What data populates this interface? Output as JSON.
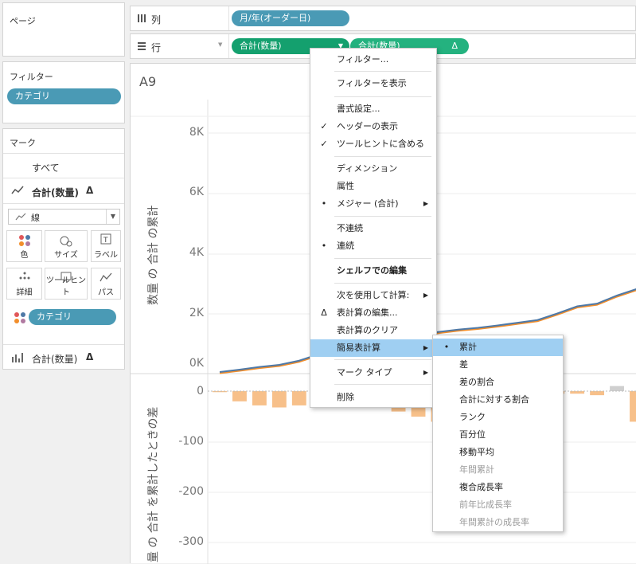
{
  "pages": {
    "title": "ページ"
  },
  "filters": {
    "title": "フィルター",
    "pill": "カテゴリ"
  },
  "marks": {
    "title": "マーク",
    "all": "すべて",
    "measure": "合計(数量)",
    "delta": "Δ",
    "type_select": "線",
    "buttons": {
      "color": "色",
      "size": "サイズ",
      "label": "ラベル",
      "detail": "詳細",
      "tooltip": "ツールヒント",
      "path": "パス"
    },
    "category_pill": "カテゴリ",
    "second_measure": "合計(数量)"
  },
  "shelves": {
    "columns_label": "列",
    "columns_pill": "月/年(オーダー日)",
    "rows_label": "行",
    "rows_pill1": "合計(数量)",
    "rows_pill2": "合計(数量)",
    "delta": "Δ"
  },
  "chart": {
    "sheet_title": "A9",
    "top_ticks": [
      "8K",
      "6K",
      "4K",
      "2K",
      "0K"
    ],
    "top_axis_title": "数量 の 合計 の累計",
    "bottom_ticks": [
      "0",
      "-100",
      "-200",
      "-300"
    ],
    "bottom_axis_title": "量 の 合計 を累計したときの差",
    "colors": {
      "line_blue": "#4e79a7",
      "line_orange": "#f28e2b",
      "bar_orange": "#f7c08a",
      "bar_gray": "#cfcfcf"
    }
  },
  "chart_data": {
    "type": "line",
    "panes": [
      {
        "type": "line",
        "ylabel": "数量 の 合計 の累計",
        "ylim": [
          0,
          8500
        ],
        "y_ticks": [
          "0K",
          "2K",
          "4K",
          "6K",
          "8K"
        ],
        "series": [
          {
            "values": [
              0,
              80,
              170,
              240,
              380,
              600,
              780,
              920,
              1040,
              1180,
              1260,
              1340,
              1420,
              1480,
              1560,
              1650,
              1740,
              1960,
              2200,
              2290,
              2560,
              2780
            ]
          }
        ]
      },
      {
        "type": "bar",
        "ylabel": "量 の 合計 を累計したときの差",
        "ylim": [
          -340,
          10
        ],
        "y_ticks": [
          "-300",
          "-200",
          "-100",
          "0"
        ],
        "values": [
          -2,
          -20,
          -28,
          -32,
          -28,
          -20,
          -15,
          -10,
          -5,
          -40,
          -50,
          -60,
          -45,
          -30,
          -20,
          -10,
          -5,
          -5,
          -5,
          -8,
          10,
          -60
        ]
      }
    ]
  },
  "context_menu": {
    "items": [
      {
        "label": "フィルター...",
        "mark": ""
      },
      {
        "label": "フィルターを表示",
        "mark": ""
      },
      {
        "label": "書式設定...",
        "mark": ""
      },
      {
        "label": "ヘッダーの表示",
        "mark": "✓"
      },
      {
        "label": "ツールヒントに含める",
        "mark": "✓"
      },
      {
        "label": "ディメンション",
        "mark": ""
      },
      {
        "label": "属性",
        "mark": ""
      },
      {
        "label": "メジャー (合計)",
        "mark": "•"
      },
      {
        "label": "不連続",
        "mark": ""
      },
      {
        "label": "連続",
        "mark": "•"
      },
      {
        "label": "シェルフでの編集",
        "mark": ""
      },
      {
        "label": "次を使用して計算:",
        "mark": ""
      },
      {
        "label": "表計算の編集...",
        "mark": "Δ"
      },
      {
        "label": "表計算のクリア",
        "mark": ""
      },
      {
        "label": "簡易表計算",
        "mark": ""
      },
      {
        "label": "マーク タイプ",
        "mark": ""
      },
      {
        "label": "削除",
        "mark": ""
      }
    ]
  },
  "submenu": {
    "items": [
      {
        "label": "累計",
        "mark": "•"
      },
      {
        "label": "差",
        "mark": ""
      },
      {
        "label": "差の割合",
        "mark": ""
      },
      {
        "label": "合計に対する割合",
        "mark": ""
      },
      {
        "label": "ランク",
        "mark": ""
      },
      {
        "label": "百分位",
        "mark": ""
      },
      {
        "label": "移動平均",
        "mark": ""
      },
      {
        "label": "年間累計",
        "mark": ""
      },
      {
        "label": "複合成長率",
        "mark": ""
      },
      {
        "label": "前年比成長率",
        "mark": ""
      },
      {
        "label": "年間累計の成長率",
        "mark": ""
      }
    ]
  }
}
